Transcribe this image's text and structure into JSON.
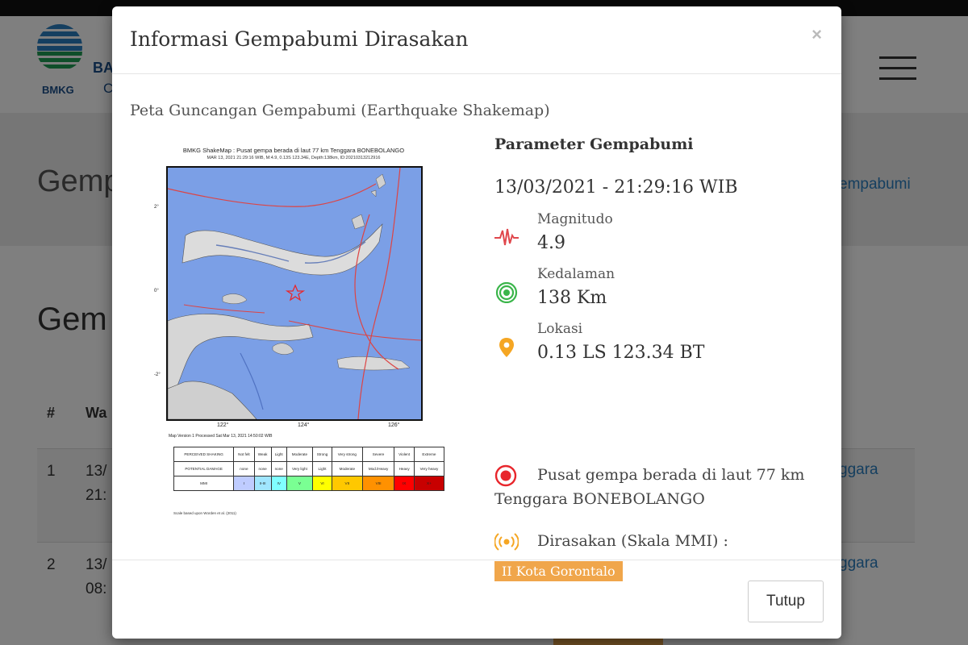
{
  "background": {
    "logo_text": "BMKG",
    "brand_line1": "BA",
    "brand_line2": "C",
    "page_heading": "Gemp",
    "breadcrumb_fragment": "empabumi",
    "section_heading": "Gem",
    "table": {
      "col_number": "#",
      "col_time": "Wa",
      "rows": [
        {
          "number": "1",
          "date": "13/",
          "time": "21:",
          "region_fragment": "ggara"
        },
        {
          "number": "2",
          "date": "13/",
          "time": "08:",
          "region_fragment": "ggara"
        }
      ]
    }
  },
  "modal": {
    "title": "Informasi Gempabumi Dirasakan",
    "close_label": "×",
    "shakemap_section_title": "Peta Guncangan Gempabumi (Earthquake Shakemap)",
    "shakemap": {
      "title": "BMKG ShakeMap : Pusat gempa berada di laut 77 km Tenggara BONEBOLANGO",
      "subtitle": "MAR 13, 2021 21:29:16 WIB, M:4.9, 0.13S 123.34E, Depth:138km, ID:20210313212916",
      "lat_labels": [
        "2°",
        "0°",
        "-2°"
      ],
      "lon_labels": [
        "122°",
        "124°",
        "126°"
      ],
      "footer": "Map Version 1 Processed Sat Mar 13, 2021 14:50:02 WIB",
      "legend": {
        "rows": [
          {
            "header": "PERCEIVED SHAKING",
            "cells": [
              "Not felt",
              "Weak",
              "Light",
              "Moderate",
              "Strong",
              "Very strong",
              "Severe",
              "Violent",
              "Extreme"
            ]
          },
          {
            "header": "POTENTIAL DAMAGE",
            "cells": [
              "none",
              "none",
              "none",
              "Very light",
              "Light",
              "Moderate",
              "Mod./Heavy",
              "Heavy",
              "Very heavy"
            ]
          },
          {
            "header": "MMI",
            "cells": [
              "I",
              "II-III",
              "IV",
              "V",
              "VI",
              "VII",
              "VIII",
              "IX",
              "X+"
            ]
          }
        ],
        "mmi_colors": [
          "#ffffff",
          "#bfccff",
          "#a0e6ff",
          "#80ffff",
          "#7aff93",
          "#ffff00",
          "#ffc800",
          "#ff9100",
          "#ff0000",
          "#c80000"
        ],
        "note": "Scale based upon Worden et al. (2011)"
      }
    },
    "parameters": {
      "heading": "Parameter Gempabumi",
      "datetime": "13/03/2021 - 21:29:16 WIB",
      "magnitude_label": "Magnitudo",
      "magnitude_value": "4.9",
      "depth_label": "Kedalaman",
      "depth_value": "138 Km",
      "location_label": "Lokasi",
      "location_value": "0.13 LS 123.34 BT",
      "epicenter_text": "Pusat gempa berada di laut 77 km Tenggara BONEBOLANGO",
      "felt_label": "Dirasakan (Skala MMI) :",
      "felt_badge": "II Kota Gorontalo"
    },
    "footer": {
      "close_button": "Tutup"
    }
  },
  "colors": {
    "accent_orange": "#f0a64b",
    "magnitude_icon": "#e0474c",
    "depth_icon": "#3ab54a",
    "location_icon": "#f5a623",
    "epicenter_icon": "#e8262c",
    "felt_icon": "#f5a623",
    "sea": "#7b9fe6"
  }
}
